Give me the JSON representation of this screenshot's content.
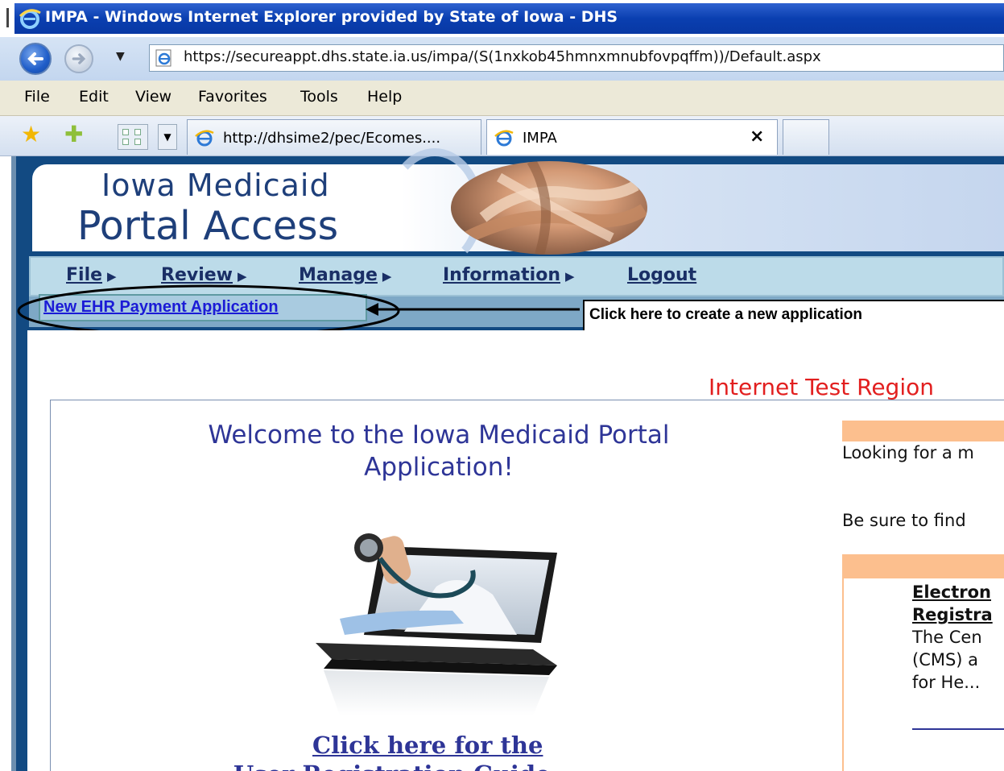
{
  "window": {
    "title": "IMPA - Windows Internet Explorer provided by State of Iowa - DHS"
  },
  "address_bar": {
    "url": "https://secureappt.dhs.state.ia.us/impa/(S(1nxkob45hmnxmnubfovpqffm))/Default.aspx"
  },
  "menu": {
    "items": [
      "File",
      "Edit",
      "View",
      "Favorites",
      "Tools",
      "Help"
    ]
  },
  "tabs": [
    {
      "label": "http://dhsime2/pec/Ecomes...."
    },
    {
      "label": "IMPA",
      "close": "×"
    }
  ],
  "banner": {
    "line1": "Iowa Medicaid",
    "line2": "Portal Access"
  },
  "nav": {
    "items": [
      {
        "label": "File",
        "has_arrow": true
      },
      {
        "label": "Review",
        "has_arrow": true
      },
      {
        "label": "Manage",
        "has_arrow": true
      },
      {
        "label": "Information",
        "has_arrow": true
      },
      {
        "label": "Logout",
        "has_arrow": false
      }
    ]
  },
  "submenu": {
    "new_app_link": "New EHR Payment Application",
    "callout": "Click here to create a new application"
  },
  "main": {
    "region": "Internet Test Region",
    "welcome": "Welcome to the Iowa Medicaid Portal Application!",
    "guide_link_line1": "Click here for the",
    "guide_link_line2": "User Registration Guide"
  },
  "right_panel": {
    "text1": "Looking for a m",
    "text2": "Be sure to find",
    "news_title": "Electron\nRegistra",
    "news_body": "The Cen\n(CMS) a\nfor He..."
  },
  "colors": {
    "titlebar": "#0a3fb0",
    "nav_bg": "#bcdbe9",
    "region_red": "#e21f1f",
    "accent_orange": "#fcbf8e",
    "heading_blue": "#2e3597"
  }
}
